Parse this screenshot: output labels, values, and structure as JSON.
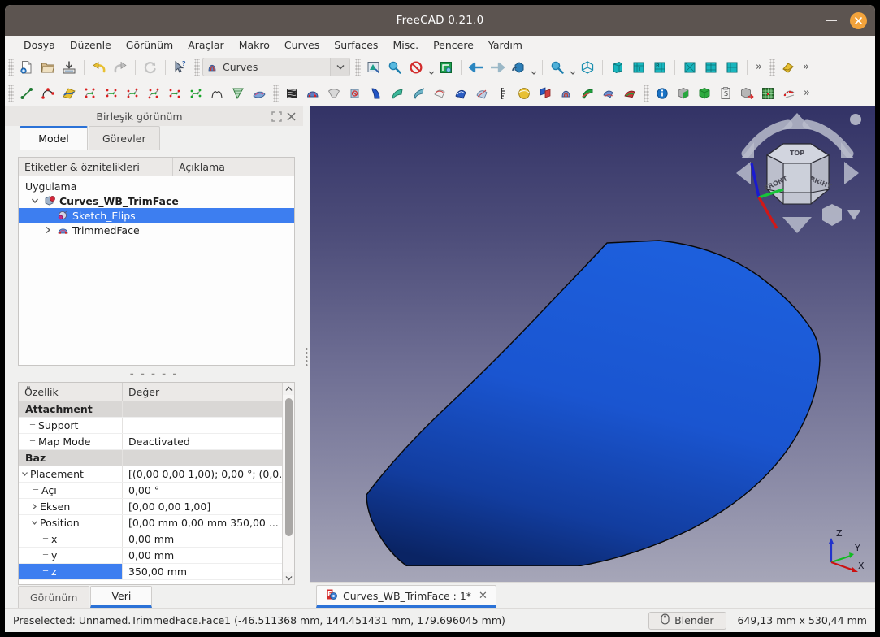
{
  "window": {
    "title": "FreeCAD 0.21.0",
    "minimize_label": "Minimize",
    "close_label": "Close"
  },
  "menubar": {
    "items": [
      {
        "label": "Dosya",
        "accel": "D"
      },
      {
        "label": "Düzenle",
        "accel": "z"
      },
      {
        "label": "Görünüm",
        "accel": "G"
      },
      {
        "label": "Araçlar",
        "accel": ""
      },
      {
        "label": "Makro",
        "accel": "M"
      },
      {
        "label": "Curves",
        "accel": ""
      },
      {
        "label": "Surfaces",
        "accel": ""
      },
      {
        "label": "Misc.",
        "accel": ""
      },
      {
        "label": "Pencere",
        "accel": "P"
      },
      {
        "label": "Yardım",
        "accel": "Y"
      }
    ]
  },
  "toolbar_row1": {
    "file_icons": [
      "new-document-icon",
      "open-folder-icon",
      "save-icon"
    ],
    "edit_icons": [
      "undo-icon",
      "redo-icon"
    ],
    "refresh_icon": "refresh-icon",
    "whats_this_icon": "whats-this-icon",
    "workbench": {
      "icon": "curves-workbench-icon",
      "value": "Curves",
      "caret": "chevron-down-icon"
    },
    "view_icons": [
      "fit-all-icon",
      "zoom-box-icon",
      "draw-style-icon",
      "toggle-axis-cross-icon",
      "back-arrow-icon",
      "forward-arrow-icon",
      "std-views-icon",
      "zoom-in-icon",
      "isometric-icon",
      "front-view-icon",
      "top-view-icon",
      "right-view-icon",
      "rear-view-icon",
      "bottom-view-icon",
      "left-view-icon"
    ],
    "overflow_label": "»",
    "extra_icon": "measure-icon",
    "overflow2_label": "»"
  },
  "toolbar_row2": {
    "curve_icons": [
      "line-icon",
      "gordon-curve-icon",
      "editable-spline-icon",
      "interpolate-icon",
      "approximate-icon",
      "parametric-curve-icon",
      "blend-curve-icon",
      "curve-extend-icon",
      "join-curve-icon",
      "discretize-icon",
      "isocurve-icon",
      "sketch-on-surface-icon"
    ],
    "surface_icons": [
      "surface-map-icon",
      "trim-face-icon",
      "flatten-face-icon",
      "pipeshell-icon",
      "blend-surface-icon",
      "sweep2rails-icon",
      "profile-support-icon",
      "segment-surface-icon",
      "gordon-surface-icon",
      "reflect-lines-icon",
      "comb-plot-icon",
      "zebra-icon",
      "sphere-icon",
      "multi-loft-icon",
      "curves-extract-icon",
      "pipe-shell-icon",
      "split-surface-icon",
      "sublink-icon"
    ],
    "misc_icons": [
      "info-icon",
      "box-green-icon",
      "solid-green-icon",
      "clipboard-icon",
      "export-box-icon",
      "grid-icon",
      "point-cloud-icon"
    ],
    "overflow_label": "»"
  },
  "left_panel": {
    "header": {
      "title": "Birleşik görünüm",
      "float_icon": "undock-icon",
      "close_icon": "close-icon"
    },
    "tabs": [
      {
        "label": "Model",
        "active": true
      },
      {
        "label": "Görevler",
        "active": false
      }
    ],
    "tree": {
      "columns": [
        "Etiketler & öznitelikleri",
        "Açıklama"
      ],
      "rows": [
        {
          "label": "Uygulama",
          "level": 0,
          "icon": "",
          "expander": "",
          "bold": false,
          "selected": false
        },
        {
          "label": "Curves_WB_TrimFace",
          "level": 1,
          "icon": "document-icon",
          "expander": "expanded",
          "bold": true,
          "selected": false
        },
        {
          "label": "Sketch_Elips",
          "level": 2,
          "icon": "sketch-icon",
          "expander": "",
          "bold": false,
          "selected": true
        },
        {
          "label": "TrimmedFace",
          "level": 2,
          "icon": "trimmed-face-icon",
          "expander": "collapsed",
          "bold": false,
          "selected": false
        }
      ]
    },
    "splitter_handle": "- - - - -",
    "properties": {
      "columns": [
        "Özellik",
        "Değer"
      ],
      "rows": [
        {
          "name": "Attachment",
          "value": "",
          "kind": "group",
          "indent": 0,
          "branch": "",
          "selected": false
        },
        {
          "name": "Support",
          "value": "",
          "kind": "row",
          "indent": 1,
          "branch": "leaf",
          "selected": false
        },
        {
          "name": "Map Mode",
          "value": "Deactivated",
          "kind": "row",
          "indent": 1,
          "branch": "leaf-end",
          "selected": false
        },
        {
          "name": "Baz",
          "value": "",
          "kind": "group",
          "indent": 0,
          "branch": "",
          "selected": false
        },
        {
          "name": "Placement",
          "value": "[(0,00 0,00 1,00); 0,00 °; (0,0...",
          "kind": "row",
          "indent": 0,
          "branch": "expanded",
          "selected": false
        },
        {
          "name": "Açı",
          "value": "0,00 °",
          "kind": "row",
          "indent": 1,
          "branch": "leaf",
          "selected": false
        },
        {
          "name": "Eksen",
          "value": "[0,00 0,00 1,00]",
          "kind": "row",
          "indent": 1,
          "branch": "collapsed",
          "selected": false
        },
        {
          "name": "Position",
          "value": "[0,00 mm  0,00 mm  350,00 ...",
          "kind": "row",
          "indent": 1,
          "branch": "expanded",
          "selected": false
        },
        {
          "name": "x",
          "value": "0,00 mm",
          "kind": "row",
          "indent": 2,
          "branch": "leaf",
          "selected": false
        },
        {
          "name": "y",
          "value": "0,00 mm",
          "kind": "row",
          "indent": 2,
          "branch": "leaf",
          "selected": false
        },
        {
          "name": "z",
          "value": "350,00 mm",
          "kind": "row",
          "indent": 2,
          "branch": "leaf-end",
          "selected": true
        }
      ],
      "scroll_up_icon": "chevron-up-icon",
      "scroll_down_icon": "chevron-down-icon"
    },
    "bottom_tabs": [
      {
        "label": "Görünüm",
        "active": false
      },
      {
        "label": "Veri",
        "active": true
      }
    ]
  },
  "view3d": {
    "navigation_cube": {
      "top_label": "TOP",
      "front_label": "FRONT",
      "right_label": "RIGHT",
      "arrow_up_icon": "nav-arrow-up-icon",
      "arrow_down_icon": "nav-arrow-down-icon",
      "arrow_left_icon": "nav-arrow-left-icon",
      "arrow_right_icon": "nav-arrow-right-icon",
      "rotate_left_icon": "nav-rotate-left-icon",
      "rotate_right_icon": "nav-rotate-right-icon",
      "corner_dot_icon": "nav-corner-dot-icon",
      "view_menu_icon": "nav-view-menu-icon"
    },
    "axis_cross": {
      "x_label": "X",
      "y_label": "Y",
      "z_label": "Z",
      "x_color": "#cc1111",
      "y_color": "#11bb22",
      "z_color": "#2233cc"
    },
    "shape": {
      "name": "trimmed-face-surface",
      "fill_top": "#1b5ad6",
      "fill_bottom": "#0b2a78",
      "edge_color": "#0a0a0a"
    },
    "background_top": "#333366",
    "background_bottom": "#a6a6b8"
  },
  "document_tab": {
    "icon": "freecad-document-icon",
    "label": "Curves_WB_TrimFace : 1*",
    "close_icon": "close-icon"
  },
  "statusbar": {
    "message": "Preselected: Unnamed.TrimmedFace.Face1 (-46.511368 mm, 144.451431 mm, 179.696045 mm)",
    "blender_button": {
      "icon": "mouse-icon",
      "label": "Blender"
    },
    "dimensions": "649,13 mm x 530,44 mm"
  }
}
